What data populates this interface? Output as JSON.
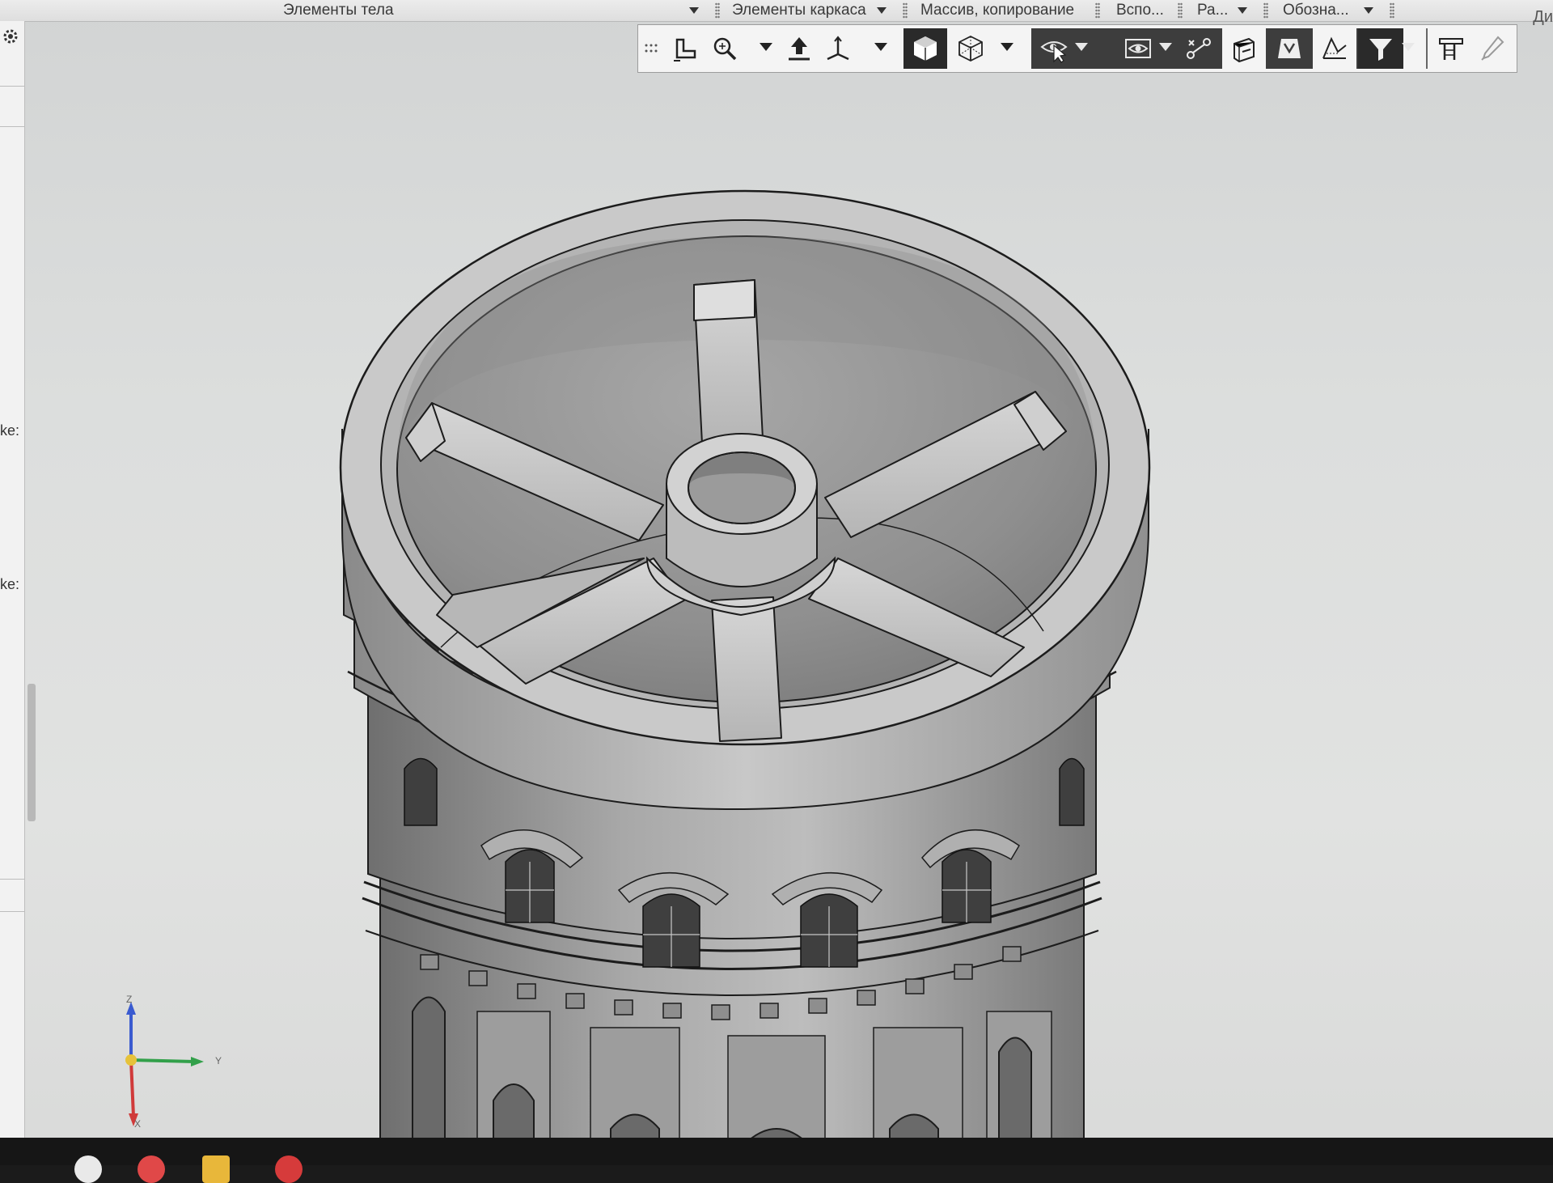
{
  "tabstrip": {
    "tabs": [
      {
        "label": "Элементы тела"
      },
      {
        "label": "Элементы каркаса"
      },
      {
        "label": "Массив, копирование"
      },
      {
        "label": "Вспо..."
      },
      {
        "label": "Ра..."
      },
      {
        "label": "Обозна..."
      }
    ],
    "corner_label": "Ди"
  },
  "toolbar": {
    "buttons": [
      {
        "icon": "drag-grip-icon"
      },
      {
        "icon": "sketch-plane-icon"
      },
      {
        "icon": "zoom-icon"
      },
      {
        "icon": "pan-icon"
      },
      {
        "icon": "orientation-icon"
      },
      {
        "icon": "shaded-solid-icon",
        "active": true
      },
      {
        "icon": "wireframe-icon"
      },
      {
        "icon": "hide-cursor-icon"
      },
      {
        "icon": "visibility-icon"
      },
      {
        "icon": "constraints-icon"
      },
      {
        "icon": "section-icon"
      },
      {
        "icon": "materials-icon"
      },
      {
        "icon": "measure-icon"
      },
      {
        "icon": "filter-icon"
      },
      {
        "icon": "structure-icon"
      },
      {
        "icon": "pipette-icon"
      }
    ]
  },
  "left_panel": {
    "labels": [
      {
        "text": "ke:"
      },
      {
        "text": "ke:"
      }
    ]
  },
  "triad": {
    "z_label": "Z",
    "y_label": "Y",
    "x_label": "X"
  },
  "colors": {
    "background": "#dcdedd",
    "model_gray": "#a8a8a8",
    "edge": "#1c1c1c",
    "toolbar_dark": "#2a2a2a"
  }
}
